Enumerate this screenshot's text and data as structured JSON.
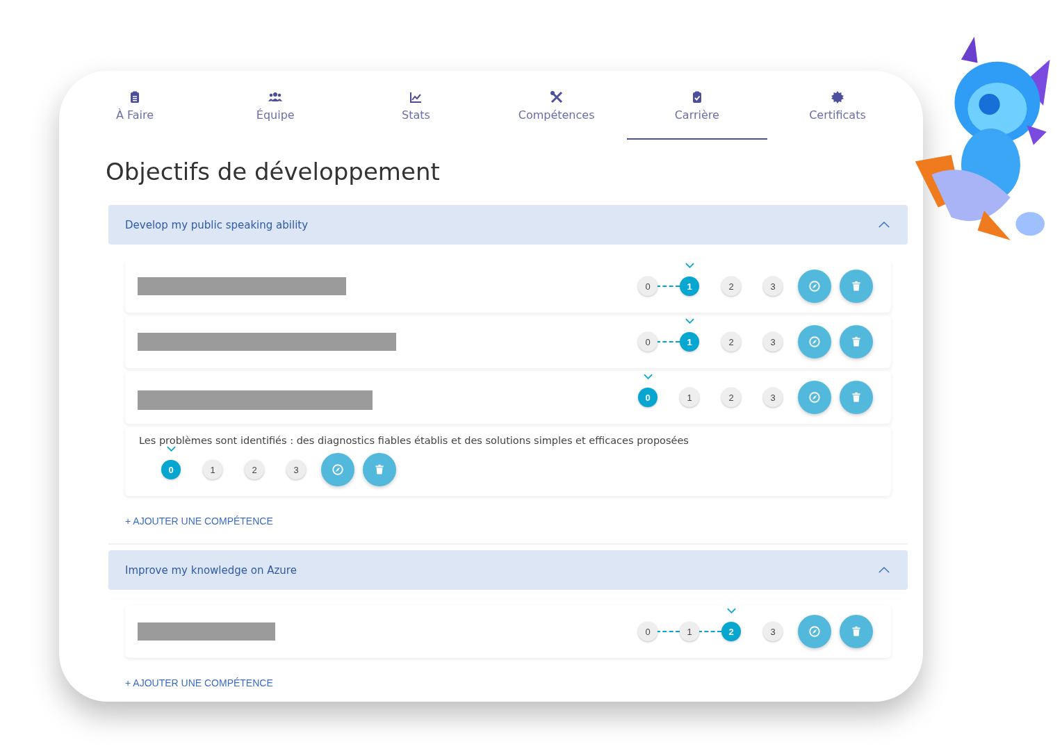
{
  "tabs": [
    {
      "label": "À Faire",
      "selected": false
    },
    {
      "label": "Équipe",
      "selected": false
    },
    {
      "label": "Stats",
      "selected": false
    },
    {
      "label": "Compétences",
      "selected": false
    },
    {
      "label": "Carrière",
      "selected": true
    },
    {
      "label": "Certificats",
      "selected": false
    }
  ],
  "title": "Objectifs de développement",
  "goals": [
    {
      "title": "Develop my public speaking ability",
      "expanded": true,
      "add_label": "+ AJOUTER UNE COMPÉTENCE",
      "skills": [
        {
          "kind": "redacted",
          "levels": [
            {
              "label": "0",
              "selected": false
            },
            {
              "label": "1",
              "selected": true
            },
            {
              "label": "2",
              "selected": false
            },
            {
              "label": "3",
              "selected": false
            }
          ]
        },
        {
          "kind": "redacted",
          "levels": [
            {
              "label": "0",
              "selected": false
            },
            {
              "label": "1",
              "selected": true
            },
            {
              "label": "2",
              "selected": false
            },
            {
              "label": "3",
              "selected": false
            }
          ]
        },
        {
          "kind": "redacted",
          "levels": [
            {
              "label": "0",
              "selected": true
            },
            {
              "label": "1",
              "selected": false
            },
            {
              "label": "2",
              "selected": false
            },
            {
              "label": "3",
              "selected": false
            }
          ]
        },
        {
          "kind": "text",
          "text": "Les problèmes sont identifiés : des diagnostics fiables établis et des solutions simples et efficaces proposées",
          "levels": [
            {
              "label": "0",
              "selected": true
            },
            {
              "label": "1",
              "selected": false
            },
            {
              "label": "2",
              "selected": false
            },
            {
              "label": "3",
              "selected": false
            }
          ]
        }
      ]
    },
    {
      "title": "Improve my knowledge on Azure",
      "expanded": true,
      "add_label": "+ AJOUTER UNE COMPÉTENCE",
      "skills": [
        {
          "kind": "redacted",
          "levels": [
            {
              "label": "0",
              "selected": false
            },
            {
              "label": "1",
              "selected": false
            },
            {
              "label": "2",
              "selected": true
            },
            {
              "label": "3",
              "selected": false
            }
          ]
        }
      ]
    }
  ]
}
